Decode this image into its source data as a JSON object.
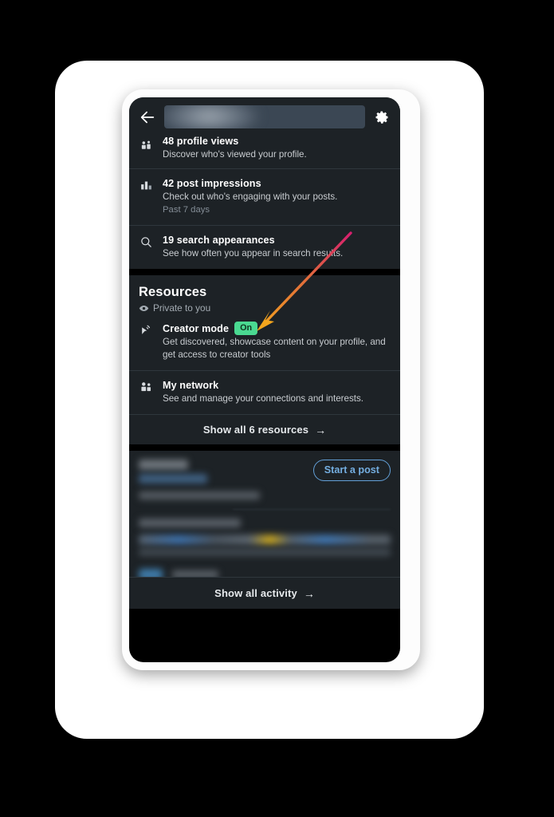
{
  "app": {
    "platform": "mobile-app-screenshot",
    "theme": "dark"
  },
  "header": {
    "back_icon": "back-arrow-icon",
    "search_value": "",
    "search_placeholder": "",
    "search_redacted": true,
    "settings_icon": "gear-icon"
  },
  "dashboard": {
    "stats": [
      {
        "icon": "profile-views-icon",
        "title": "48 profile views",
        "subtitle": "Discover who's viewed your profile.",
        "meta": "",
        "clipped": true
      },
      {
        "icon": "bar-chart-icon",
        "title": "42 post impressions",
        "subtitle": "Check out who's engaging with your posts.",
        "meta": "Past 7 days",
        "clipped": false
      },
      {
        "icon": "search-icon",
        "title": "19 search appearances",
        "subtitle": "See how often you appear in search results.",
        "meta": "",
        "clipped": false
      }
    ]
  },
  "resources": {
    "title": "Resources",
    "privacy_icon": "eye-icon",
    "privacy_label": "Private to you",
    "items": [
      {
        "icon": "creator-mode-icon",
        "title": "Creator mode",
        "badge": "On",
        "badge_color": "#4ad991",
        "subtitle": "Get discovered, showcase content on your profile, and get access to creator tools"
      },
      {
        "icon": "my-network-icon",
        "title": "My network",
        "badge": "",
        "subtitle": "See and manage your connections and interests."
      }
    ],
    "show_all_label": "Show all 6 resources",
    "show_all_arrow": "→"
  },
  "activity": {
    "name_redacted": true,
    "start_post_label": "Start a post",
    "show_all_label": "Show all activity",
    "show_all_arrow": "→"
  },
  "annotation": {
    "type": "arrow",
    "target": "creator-mode-on-badge",
    "gradient_start": "#d61f6e",
    "gradient_end": "#f0a022"
  }
}
